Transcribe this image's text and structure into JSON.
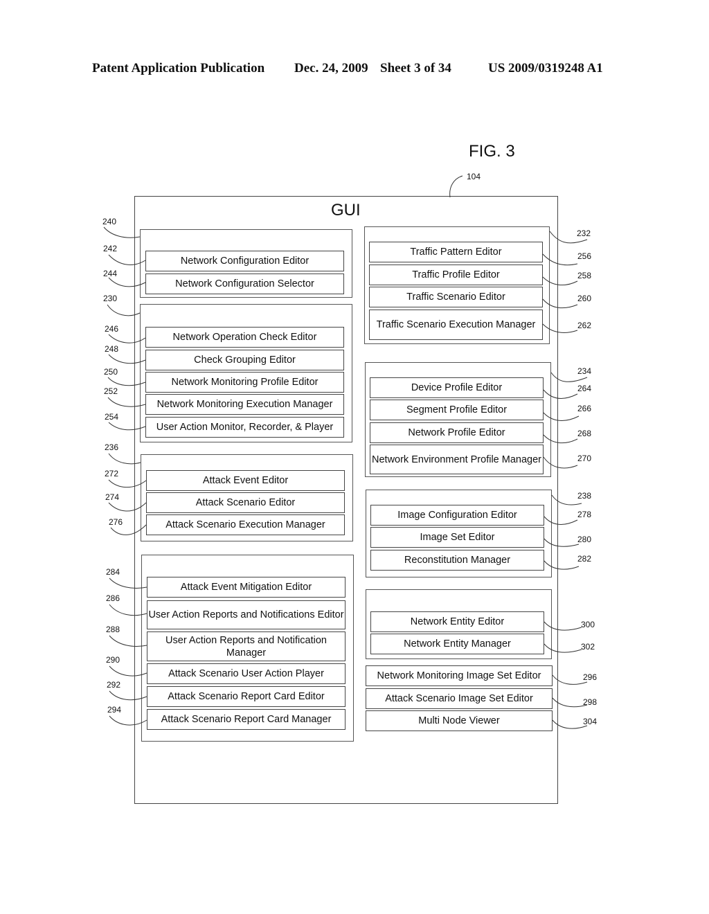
{
  "header": {
    "publication": "Patent Application Publication",
    "date": "Dec. 24, 2009",
    "sheet": "Sheet 3 of 34",
    "number": "US 2009/0319248 A1"
  },
  "figure": {
    "label": "FIG. 3",
    "gui_ref": "104",
    "gui_title": "GUI"
  },
  "left_groups": [
    {
      "ref": "240",
      "items": [
        {
          "ref": "242",
          "label": "Network Configuration Editor"
        },
        {
          "ref": "244",
          "label": "Network Configuration Selector"
        }
      ]
    },
    {
      "ref": "230",
      "items": [
        {
          "ref": "246",
          "label": "Network Operation Check Editor"
        },
        {
          "ref": "248",
          "label": "Check Grouping Editor"
        },
        {
          "ref": "250",
          "label": "Network Monitoring Profile Editor"
        },
        {
          "ref": "252",
          "label": "Network Monitoring Execution Manager"
        },
        {
          "ref": "254",
          "label": "User Action Monitor, Recorder, & Player"
        }
      ]
    },
    {
      "ref": "236",
      "items": [
        {
          "ref": "272",
          "label": "Attack Event Editor"
        },
        {
          "ref": "274",
          "label": "Attack Scenario Editor"
        },
        {
          "ref": "276",
          "label": "Attack Scenario Execution Manager"
        }
      ]
    },
    {
      "ref": "",
      "items": [
        {
          "ref": "284",
          "label": "Attack Event Mitigation Editor"
        },
        {
          "ref": "286",
          "label": "User Action Reports and Notifications Editor"
        },
        {
          "ref": "288",
          "label": "User Action Reports and Notification Manager"
        },
        {
          "ref": "290",
          "label": "Attack Scenario User Action Player"
        },
        {
          "ref": "292",
          "label": "Attack Scenario Report Card Editor"
        },
        {
          "ref": "294",
          "label": "Attack Scenario Report Card Manager"
        }
      ]
    }
  ],
  "right_groups": [
    {
      "ref": "232",
      "items": [
        {
          "ref": "256",
          "label": "Traffic Pattern Editor"
        },
        {
          "ref": "258",
          "label": "Traffic Profile Editor"
        },
        {
          "ref": "260",
          "label": "Traffic Scenario Editor"
        },
        {
          "ref": "262",
          "label": "Traffic Scenario Execution Manager"
        }
      ]
    },
    {
      "ref": "234",
      "items": [
        {
          "ref": "264",
          "label": "Device Profile Editor"
        },
        {
          "ref": "266",
          "label": "Segment Profile Editor"
        },
        {
          "ref": "268",
          "label": "Network Profile Editor"
        },
        {
          "ref": "270",
          "label": "Network Environment Profile Manager"
        }
      ]
    },
    {
      "ref": "238",
      "items": [
        {
          "ref": "278",
          "label": "Image Configuration Editor"
        },
        {
          "ref": "280",
          "label": "Image Set Editor"
        },
        {
          "ref": "282",
          "label": "Reconstitution Manager"
        }
      ]
    },
    {
      "ref": "",
      "items": [
        {
          "ref": "300",
          "label": "Network Entity Editor"
        },
        {
          "ref": "302",
          "label": "Network Entity Manager"
        }
      ]
    }
  ],
  "standalone_items": [
    {
      "ref": "296",
      "label": "Network Monitoring Image Set Editor"
    },
    {
      "ref": "298",
      "label": "Attack Scenario Image Set Editor"
    },
    {
      "ref": "304",
      "label": "Multi Node Viewer"
    }
  ]
}
